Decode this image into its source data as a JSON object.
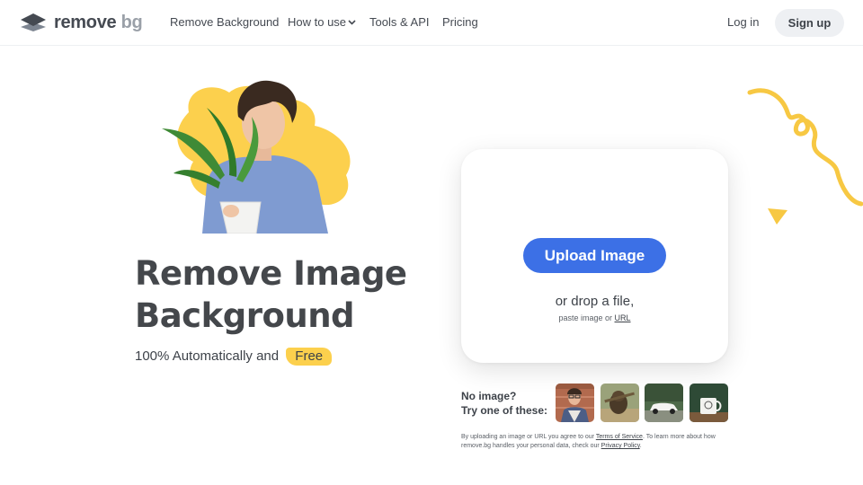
{
  "header": {
    "logo": {
      "word": "remove",
      "accent": "bg",
      "icon": "layers-logo-icon"
    },
    "nav": [
      {
        "label": "Remove Background"
      },
      {
        "label": "How to use",
        "icon": "chevron-down-icon"
      },
      {
        "label": "Tools & API"
      },
      {
        "label": "Pricing"
      }
    ],
    "login_label": "Log in",
    "signup_label": "Sign up"
  },
  "hero": {
    "title_line1": "Remove Image",
    "title_line2": "Background",
    "subtitle": "100% Automatically and",
    "free_badge": "Free"
  },
  "upload": {
    "button_label": "Upload Image",
    "drop_text": "or drop a file,",
    "paste_text": "paste image or",
    "url_link": "URL"
  },
  "samples": {
    "prompt_line1": "No image?",
    "prompt_line2": "Try one of these:",
    "items": [
      {
        "subject": "man-with-glasses"
      },
      {
        "subject": "dog-with-stick"
      },
      {
        "subject": "white-car"
      },
      {
        "subject": "mug-on-table"
      }
    ]
  },
  "legal": {
    "prefix": "By uploading an image or URL you agree to our",
    "terms_link": "Terms of Service",
    "middle": ". To learn more about how remove.bg handles your personal data, check our",
    "privacy_link": "Privacy Policy",
    "suffix": "."
  },
  "colors": {
    "accent_blue": "#3c70e6",
    "yellow": "#fcd04d",
    "text": "#3d4249"
  }
}
